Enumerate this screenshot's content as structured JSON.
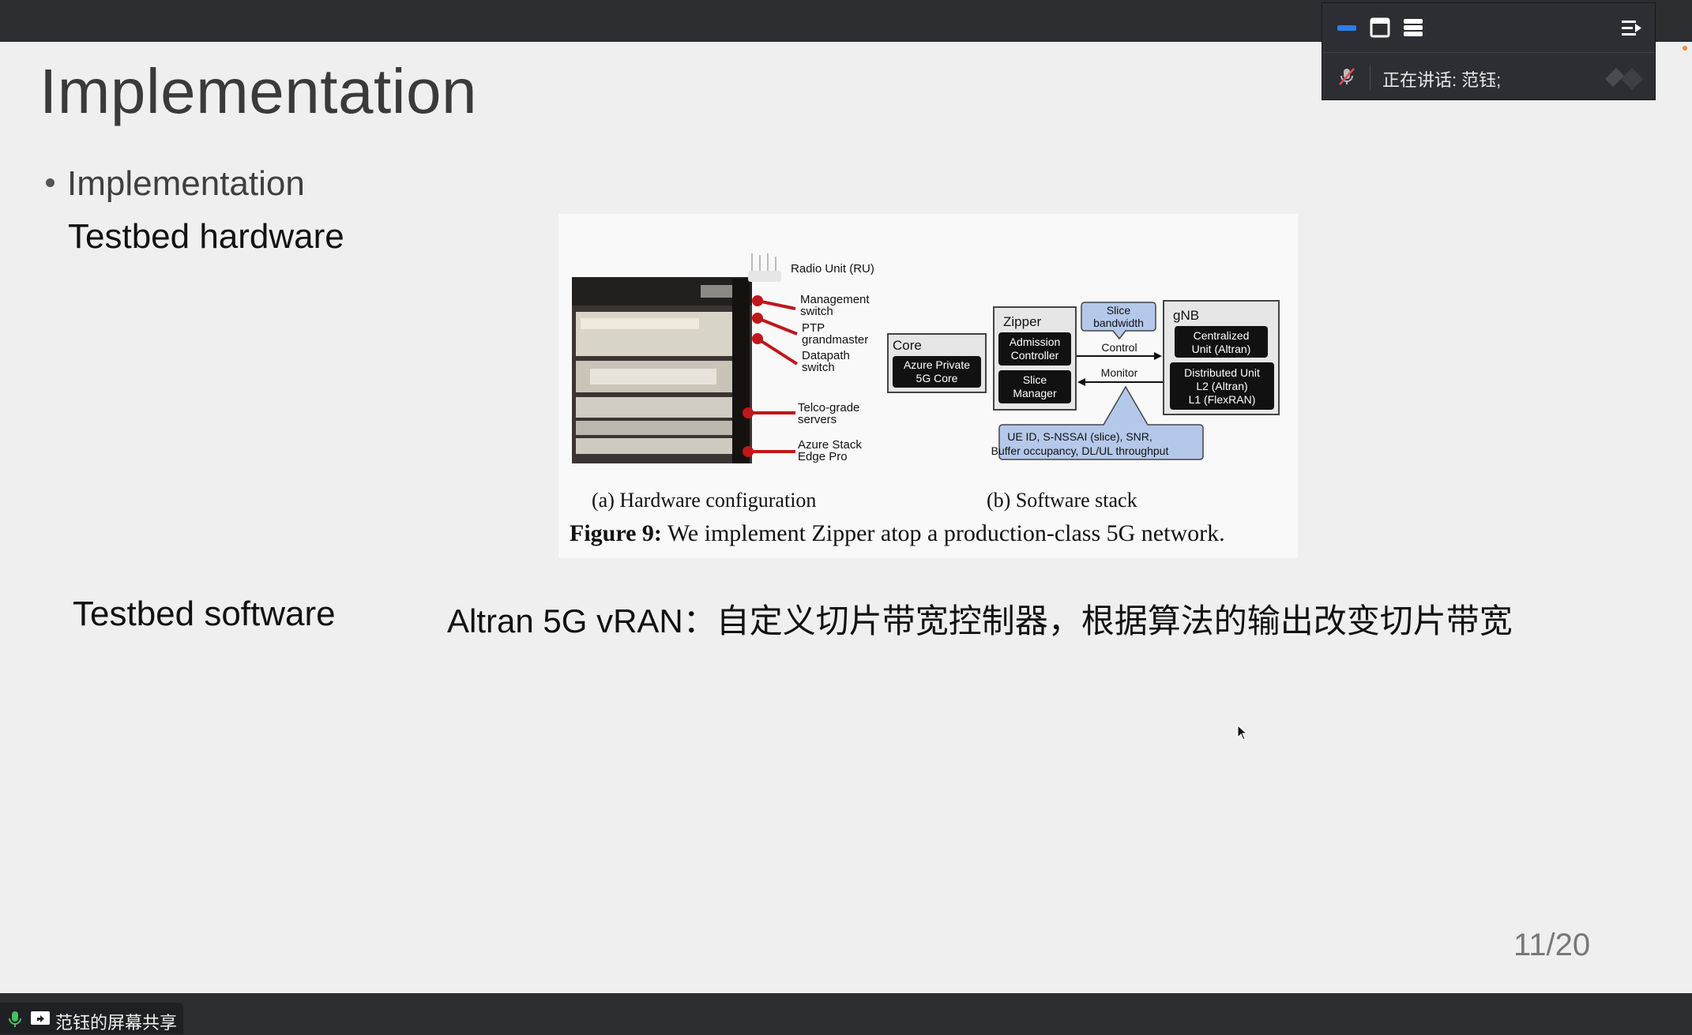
{
  "slide": {
    "title": "Implementation",
    "bullet": "Implementation",
    "hardware_label": "Testbed hardware",
    "software_label": "Testbed software",
    "software_desc": "Altran 5G vRAN：自定义切片带宽控制器，根据算法的输出改变切片带宽",
    "page_number": "11/20"
  },
  "figure": {
    "hw_labels": {
      "ru": "Radio Unit (RU)",
      "mgmt1": "Management",
      "mgmt2": "switch",
      "ptp1": "PTP",
      "ptp2": "grandmaster",
      "dp1": "Datapath",
      "dp2": "switch",
      "telco1": "Telco-grade",
      "telco2": "servers",
      "azure1": "Azure Stack",
      "azure2": "Edge Pro"
    },
    "sw": {
      "core_title": "Core",
      "core_box1": "Azure Private",
      "core_box2": "5G Core",
      "zipper_title": "Zipper",
      "admission1": "Admission",
      "admission2": "Controller",
      "slice_mgr1": "Slice",
      "slice_mgr2": "Manager",
      "slice_bw1": "Slice",
      "slice_bw2": "bandwidth",
      "control": "Control",
      "monitor": "Monitor",
      "gnb_title": "gNB",
      "cu1": "Centralized",
      "cu2": "Unit (Altran)",
      "du1": "Distributed Unit",
      "du2": "L2 (Altran)",
      "du3": "L1 (FlexRAN)",
      "ue1": "UE ID, S-NSSAI (slice), SNR,",
      "ue2": "Buffer occupancy, DL/UL throughput"
    },
    "caption_a": "(a) Hardware configuration",
    "caption_b": "(b) Software stack",
    "caption_bold": "Figure 9:",
    "caption_text": " We implement Zipper atop a production-class 5G network."
  },
  "meeting_panel": {
    "speaking_label": "正在讲话:",
    "speaker": "范钰;",
    "icons": [
      "minimize-icon",
      "window-icon",
      "list-view-icon",
      "collapse-panel-icon",
      "mic-muted-icon"
    ]
  },
  "share_bar": {
    "label": "范钰的屏幕共享",
    "icons": [
      "mic-icon",
      "screen-share-icon"
    ]
  },
  "colors": {
    "chrome": "#2b2d31",
    "slide_bg": "#efefef",
    "accent_blue": "#2b7de9",
    "bubble_blue": "#b4c8ea",
    "mic_green": "#3fc35a"
  }
}
